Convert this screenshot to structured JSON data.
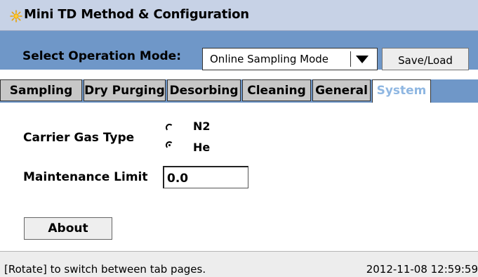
{
  "window": {
    "title": "Mini TD Method & Configuration",
    "icon": "sun-icon"
  },
  "mode": {
    "label": "Select Operation Mode:",
    "selected": "Online Sampling Mode",
    "save_label": "Save/Load"
  },
  "tabs": [
    {
      "label": "Sampling",
      "active": false
    },
    {
      "label": "Dry Purging",
      "active": false
    },
    {
      "label": "Desorbing",
      "active": false
    },
    {
      "label": "Cleaning",
      "active": false
    },
    {
      "label": "General",
      "active": false
    },
    {
      "label": "System",
      "active": true
    }
  ],
  "system": {
    "carrier_gas_label": "Carrier Gas Type",
    "options": [
      {
        "label": "N2",
        "selected": false
      },
      {
        "label": "He",
        "selected": true
      }
    ],
    "maintenance_label": "Maintenance Limit",
    "maintenance_value": "0.0",
    "about_label": "About"
  },
  "status": {
    "hint": "[Rotate] to switch between tab pages.",
    "datetime": "2012-11-08 12:59:59"
  },
  "colors": {
    "title_bg": "#c7d2e6",
    "accent_blue": "#6f97c8",
    "active_tab_text": "#8fb7e2",
    "tab_bg": "#c7c7c7"
  }
}
